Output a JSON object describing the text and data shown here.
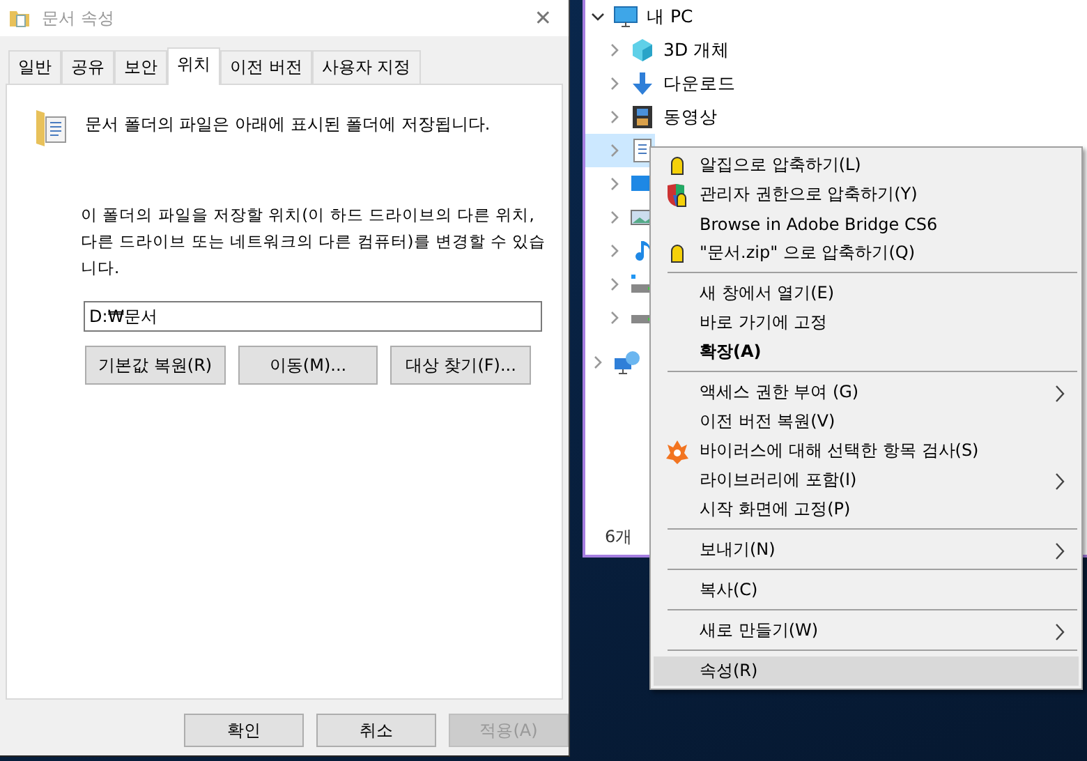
{
  "dialog": {
    "title": "문서 속성",
    "close": "✕",
    "tabs": [
      {
        "label": "일반",
        "selected": false
      },
      {
        "label": "공유",
        "selected": false
      },
      {
        "label": "보안",
        "selected": false
      },
      {
        "label": "위치",
        "selected": true
      },
      {
        "label": "이전 버전",
        "selected": false
      },
      {
        "label": "사용자 지정",
        "selected": false
      }
    ],
    "info": "문서 폴더의 파일은 아래에 표시된 폴더에 저장됩니다.",
    "description": "이 폴더의 파일을 저장할 위치(이 하드 드라이브의 다른 위치, 다른 드라이브 또는 네트워크의 다른 컴퓨터)를 변경할 수 있습니다.",
    "path": "D:₩문서",
    "actions": [
      "기본값 복원(R)",
      "이동(M)...",
      "대상 찾기(F)..."
    ],
    "buttons": [
      {
        "label": "확인",
        "disabled": false
      },
      {
        "label": "취소",
        "disabled": false
      },
      {
        "label": "적용(A)",
        "disabled": true
      }
    ]
  },
  "explorer": {
    "tree": [
      {
        "label": "내 PC",
        "kind": "monitor",
        "expanded": true,
        "selected": false,
        "children": [
          {
            "label": "3D 개체",
            "kind": "cube",
            "expanded": false,
            "selected": false
          },
          {
            "label": "다운로드",
            "kind": "download",
            "expanded": false,
            "selected": false
          },
          {
            "label": "동영상",
            "kind": "film",
            "expanded": false,
            "selected": false
          },
          {
            "kind": "document",
            "expanded": false,
            "selected": true
          },
          {
            "kind": "desktop",
            "expanded": false,
            "selected": false
          },
          {
            "kind": "image",
            "expanded": false,
            "selected": false
          },
          {
            "kind": "music",
            "expanded": false,
            "selected": false
          },
          {
            "kind": "drive-win",
            "expanded": false,
            "selected": false
          },
          {
            "kind": "drive",
            "expanded": false,
            "selected": false
          }
        ]
      },
      {
        "kind": "network",
        "expanded": false,
        "selected": false
      }
    ],
    "status": "6개"
  },
  "context_menu": [
    {
      "kind": "zip",
      "label": "알집으로 압축하기(L)",
      "submenu": false,
      "selected": false
    },
    {
      "kind": "shield-zip",
      "label": "관리자 권한으로 압축하기(Y)",
      "submenu": false,
      "selected": false
    },
    {
      "kind": "item",
      "label": "Browse in Adobe Bridge CS6",
      "submenu": false,
      "selected": false
    },
    {
      "kind": "zip",
      "label": "\"문서.zip\" 으로 압축하기(Q)",
      "submenu": false,
      "selected": false
    },
    {
      "kind": "separator"
    },
    {
      "kind": "item",
      "label": "새 창에서 열기(E)",
      "submenu": false,
      "selected": false
    },
    {
      "kind": "item",
      "label": "바로 가기에 고정",
      "submenu": false,
      "selected": false
    },
    {
      "kind": "item",
      "label": "확장(A)",
      "default": true,
      "submenu": false,
      "selected": false
    },
    {
      "kind": "separator"
    },
    {
      "kind": "item",
      "label": "액세스 권한 부여 (G)",
      "submenu": true,
      "selected": false
    },
    {
      "kind": "item",
      "label": "이전 버전 복원(V)",
      "submenu": false,
      "selected": false
    },
    {
      "kind": "antivirus",
      "label": "바이러스에 대해 선택한 항목 검사(S)",
      "submenu": false,
      "selected": false
    },
    {
      "kind": "item",
      "label": "라이브러리에 포함(I)",
      "submenu": true,
      "selected": false
    },
    {
      "kind": "item",
      "label": "시작 화면에 고정(P)",
      "submenu": false,
      "selected": false
    },
    {
      "kind": "separator"
    },
    {
      "kind": "item",
      "label": "보내기(N)",
      "submenu": true,
      "selected": false
    },
    {
      "kind": "separator"
    },
    {
      "kind": "item",
      "label": "복사(C)",
      "submenu": false,
      "selected": false
    },
    {
      "kind": "separator"
    },
    {
      "kind": "item",
      "label": "새로 만들기(W)",
      "submenu": true,
      "selected": false
    },
    {
      "kind": "separator"
    },
    {
      "kind": "item",
      "label": "속성(R)",
      "submenu": false,
      "selected": true
    }
  ]
}
